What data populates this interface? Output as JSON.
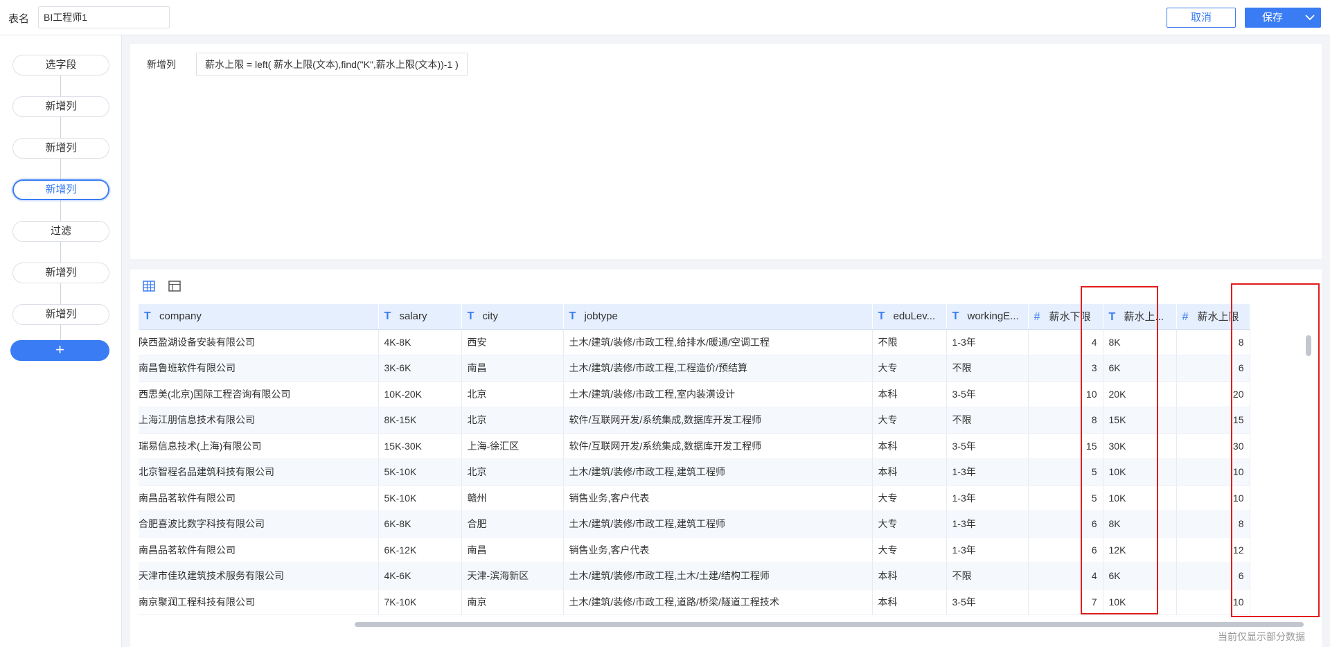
{
  "header": {
    "table_name_label": "表名",
    "table_name_value": "BI工程师1",
    "cancel_label": "取消",
    "save_label": "保存"
  },
  "steps": [
    {
      "label": "选字段",
      "active": false
    },
    {
      "label": "新增列",
      "active": false
    },
    {
      "label": "新增列",
      "active": false
    },
    {
      "label": "新增列",
      "active": true
    },
    {
      "label": "过滤",
      "active": false
    },
    {
      "label": "新增列",
      "active": false
    },
    {
      "label": "新增列",
      "active": false
    }
  ],
  "add_step_label": "+",
  "formula": {
    "label": "新增列",
    "expression": "薪水上限 = left( 薪水上限(文本),find(\"K\",薪水上限(文本))-1 )"
  },
  "table": {
    "columns": [
      {
        "icon": "T",
        "name": "company"
      },
      {
        "icon": "T",
        "name": "salary"
      },
      {
        "icon": "T",
        "name": "city"
      },
      {
        "icon": "T",
        "name": "jobtype"
      },
      {
        "icon": "T",
        "name": "eduLev..."
      },
      {
        "icon": "T",
        "name": "workingE..."
      },
      {
        "icon": "#",
        "name": "薪水下限"
      },
      {
        "icon": "T",
        "name": "薪水上..."
      },
      {
        "icon": "#",
        "name": "薪水上限"
      }
    ],
    "rows": [
      [
        "陕西盈湖设备安装有限公司",
        "4K-8K",
        "西安",
        "土木/建筑/装修/市政工程,给排水/暖通/空调工程",
        "不限",
        "1-3年",
        "4",
        "8K",
        "8"
      ],
      [
        "南昌鲁班软件有限公司",
        "3K-6K",
        "南昌",
        "土木/建筑/装修/市政工程,工程造价/预结算",
        "大专",
        "不限",
        "3",
        "6K",
        "6"
      ],
      [
        "西思美(北京)国际工程咨询有限公司",
        "10K-20K",
        "北京",
        "土木/建筑/装修/市政工程,室内装潢设计",
        "本科",
        "3-5年",
        "10",
        "20K",
        "20"
      ],
      [
        "上海江朋信息技术有限公司",
        "8K-15K",
        "北京",
        "软件/互联网开发/系统集成,数据库开发工程师",
        "大专",
        "不限",
        "8",
        "15K",
        "15"
      ],
      [
        "瑞易信息技术(上海)有限公司",
        "15K-30K",
        "上海-徐汇区",
        "软件/互联网开发/系统集成,数据库开发工程师",
        "本科",
        "3-5年",
        "15",
        "30K",
        "30"
      ],
      [
        "北京智程名品建筑科技有限公司",
        "5K-10K",
        "北京",
        "土木/建筑/装修/市政工程,建筑工程师",
        "本科",
        "1-3年",
        "5",
        "10K",
        "10"
      ],
      [
        "南昌品茗软件有限公司",
        "5K-10K",
        "赣州",
        "销售业务,客户代表",
        "大专",
        "1-3年",
        "5",
        "10K",
        "10"
      ],
      [
        "合肥喜波比数字科技有限公司",
        "6K-8K",
        "合肥",
        "土木/建筑/装修/市政工程,建筑工程师",
        "大专",
        "1-3年",
        "6",
        "8K",
        "8"
      ],
      [
        "南昌品茗软件有限公司",
        "6K-12K",
        "南昌",
        "销售业务,客户代表",
        "大专",
        "1-3年",
        "6",
        "12K",
        "12"
      ],
      [
        "天津市佳玖建筑技术服务有限公司",
        "4K-6K",
        "天津-滨海新区",
        "土木/建筑/装修/市政工程,土木/土建/结构工程师",
        "本科",
        "不限",
        "4",
        "6K",
        "6"
      ],
      [
        "南京聚润工程科技有限公司",
        "7K-10K",
        "南京",
        "土木/建筑/装修/市政工程,道路/桥梁/隧道工程技术",
        "本科",
        "3-5年",
        "7",
        "10K",
        "10"
      ]
    ],
    "numeric_columns": [
      6,
      8
    ]
  },
  "footnote": "当前仅显示部分数据",
  "colors": {
    "accent": "#3a7cf3",
    "header_bg": "#e6effd",
    "highlight": "#e21b1b"
  }
}
